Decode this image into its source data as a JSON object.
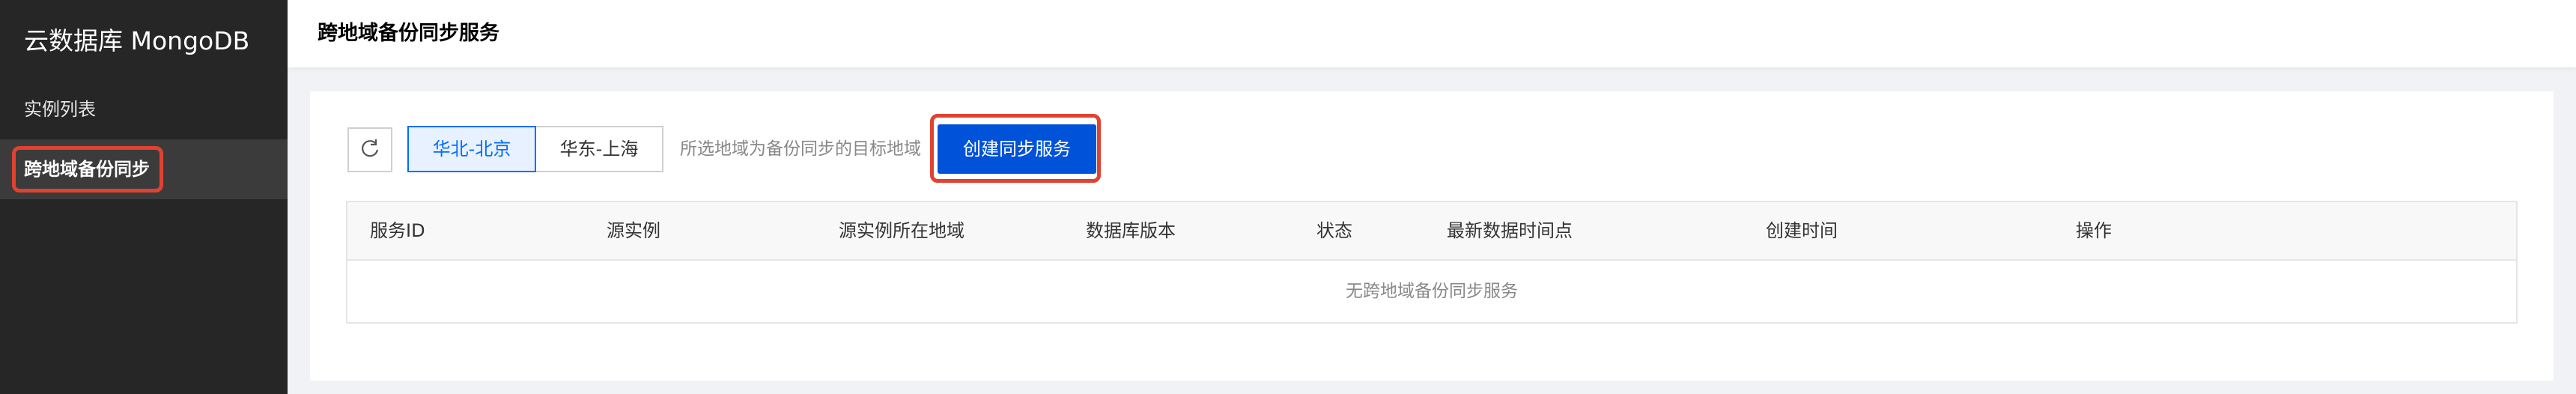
{
  "sidebar": {
    "brand": "云数据库 MongoDB",
    "items": [
      {
        "label": "实例列表"
      },
      {
        "label": "跨地域备份同步"
      }
    ]
  },
  "header": {
    "title": "跨地域备份同步服务"
  },
  "toolbar": {
    "regions": [
      "华北-北京",
      "华东-上海"
    ],
    "selected_region": "华北-北京",
    "hint": "所选地域为备份同步的目标地域",
    "create_label": "创建同步服务"
  },
  "table": {
    "columns": [
      "服务ID",
      "源实例",
      "源实例所在地域",
      "数据库版本",
      "状态",
      "最新数据时间点",
      "创建时间",
      "操作"
    ],
    "empty_text": "无跨地域备份同步服务"
  },
  "colors": {
    "sidebar_bg": "#262626",
    "accent": "#006eff",
    "primary_button": "#0052d9",
    "highlight": "#e04232"
  }
}
